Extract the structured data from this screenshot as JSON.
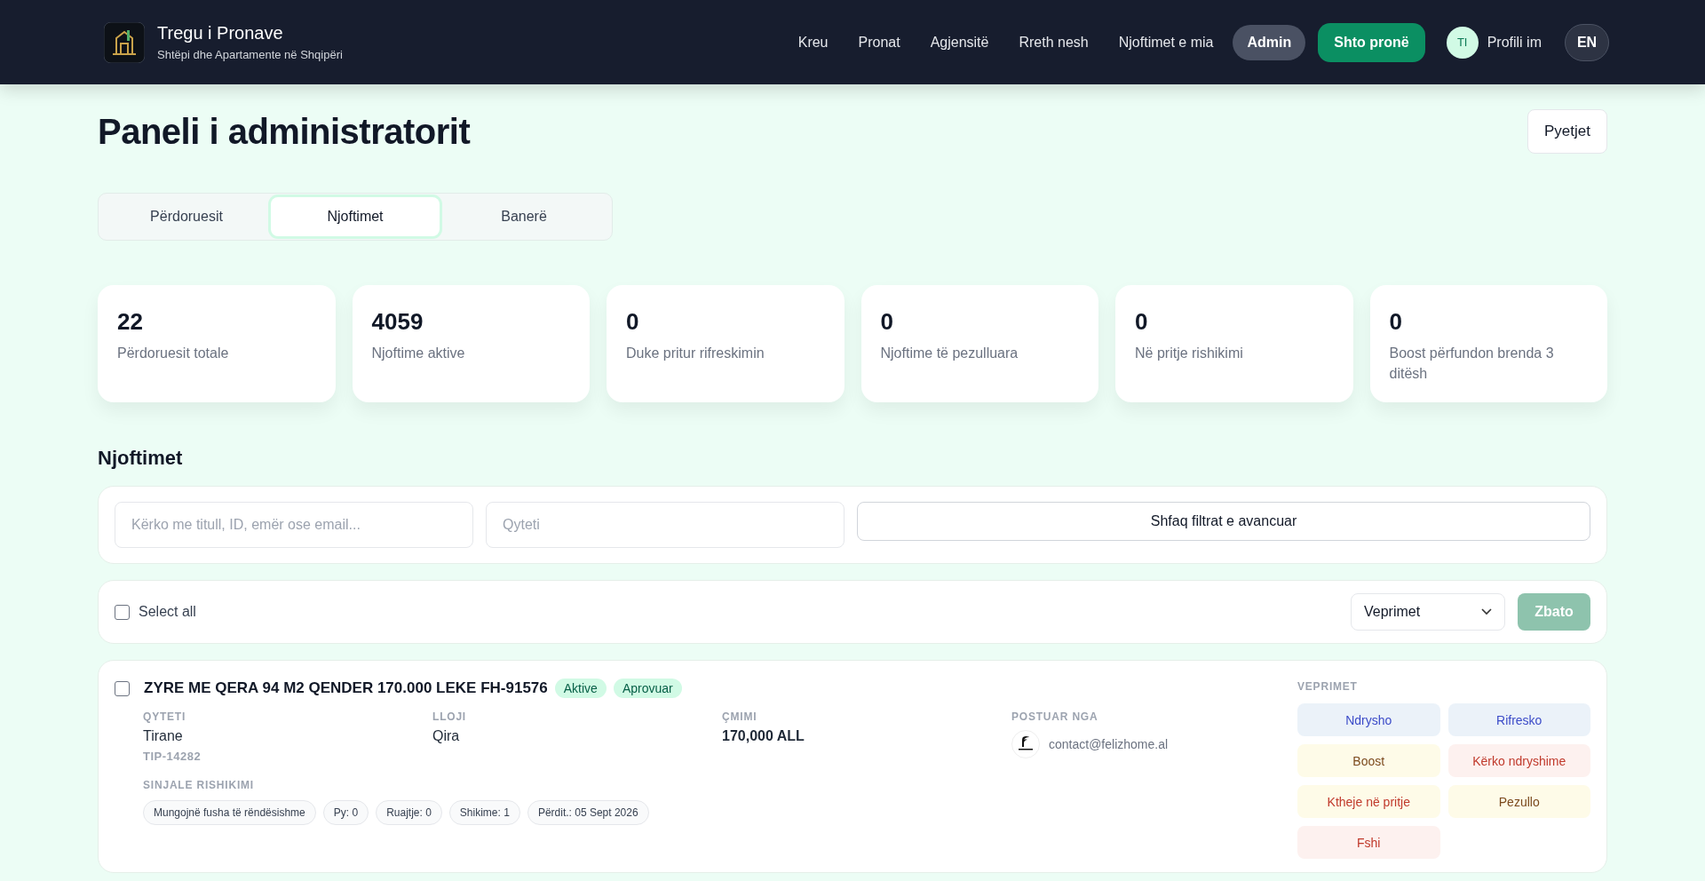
{
  "brand": {
    "title": "Tregu i Pronave",
    "subtitle": "Shtëpi dhe Apartamente në Shqipëri"
  },
  "nav": [
    {
      "label": "Kreu",
      "selected": false
    },
    {
      "label": "Pronat",
      "selected": false
    },
    {
      "label": "Agjensitë",
      "selected": false
    },
    {
      "label": "Rreth nesh",
      "selected": false
    },
    {
      "label": "Njoftimet e mia",
      "selected": false
    },
    {
      "label": "Admin",
      "selected": true
    }
  ],
  "add_button": "Shto pronë",
  "profile": {
    "initials": "TI",
    "label": "Profili im"
  },
  "language": "EN",
  "page_title": "Paneli i administratorit",
  "questions_button": "Pyetjet",
  "tabs": [
    {
      "label": "Përdoruesit",
      "selected": false
    },
    {
      "label": "Njoftimet",
      "selected": true
    },
    {
      "label": "Banerë",
      "selected": false
    }
  ],
  "stats": [
    {
      "value": "22",
      "label": "Përdoruesit totale"
    },
    {
      "value": "4059",
      "label": "Njoftime aktive"
    },
    {
      "value": "0",
      "label": "Duke pritur rifreskimin"
    },
    {
      "value": "0",
      "label": "Njoftime të pezulluara"
    },
    {
      "value": "0",
      "label": "Në pritje rishikimi"
    },
    {
      "value": "0",
      "label": "Boost përfundon brenda 3 ditësh"
    }
  ],
  "section_title": "Njoftimet",
  "filters": {
    "search_placeholder": "Kërko me titull, ID, emër ose email...",
    "city_placeholder": "Qyteti",
    "advanced_button": "Shfaq filtrat e avancuar"
  },
  "bulk": {
    "select_all": "Select all",
    "checked": false,
    "action_select": "Veprimet",
    "apply_button": "Zbato"
  },
  "listings": [
    {
      "checked": false,
      "title": "ZYRE ME QERA 94 M2 QENDER 170.000 LEKE FH-91576",
      "badges": [
        "Aktive",
        "Aprovuar"
      ],
      "fields": [
        {
          "label": "QYTETI",
          "value": "Tirane",
          "sub": "TIP-14282"
        },
        {
          "label": "LLOJI",
          "value": "Qira"
        },
        {
          "label": "ÇMIMI",
          "value": "170,000 ALL",
          "strong": true
        }
      ],
      "posted_by": {
        "label": "POSTUAR NGA",
        "email": "contact@felizhome.al"
      },
      "signals_label": "SINJALE RISHIKIMI",
      "signals": [
        "Mungojnë fusha të rëndësishme",
        "Py: 0",
        "Ruajtje: 0",
        "Shikime: 1",
        "Përdit.: 05 Sept 2026"
      ],
      "actions_label": "VEPRIMET",
      "actions": [
        {
          "label": "Ndrysho",
          "kind": "info"
        },
        {
          "label": "Rifresko",
          "kind": "info"
        },
        {
          "label": "Boost",
          "kind": "warn"
        },
        {
          "label": "Kërko ndryshime",
          "kind": "danger"
        },
        {
          "label": "Ktheje në pritje",
          "kind": "revert"
        },
        {
          "label": "Pezullo",
          "kind": "warn"
        },
        {
          "label": "Fshi",
          "kind": "danger"
        }
      ]
    }
  ]
}
